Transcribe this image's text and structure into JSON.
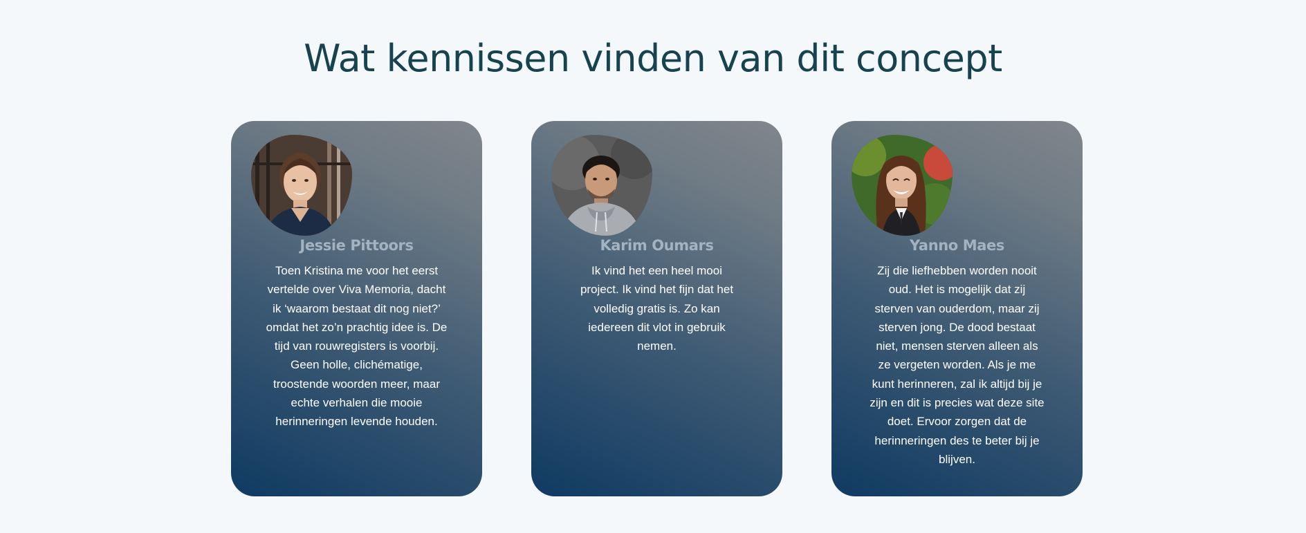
{
  "section": {
    "title": "Wat kennissen vinden van dit concept"
  },
  "testimonials": [
    {
      "name": "Jessie Pittoors",
      "quote": "Toen Kristina me voor het eerst vertelde over Viva Memoria, dacht ik ‘waarom bestaat dit nog niet?’ omdat het zo’n prachtig idee is. De tijd van rouwregisters is voorbij. Geen holle, clichématige, troostende woorden meer, maar echte verhalen die mooie herinneringen levende houden."
    },
    {
      "name": "Karim Oumars",
      "quote": "Ik vind het een heel mooi project. Ik vind het fijn dat het volledig gratis is. Zo kan iedereen dit vlot in gebruik nemen."
    },
    {
      "name": "Yanno Maes",
      "quote": "Zij die liefhebben worden nooit oud. Het is mogelijk dat zij sterven van ouderdom, maar zij sterven jong. De dood bestaat niet, mensen sterven alleen als ze vergeten worden. Als je me kunt herinneren, zal ik altijd bij je zijn en dit is precies wat deze site doet. Ervoor zorgen dat de herinneringen des te beter bij je blijven."
    }
  ],
  "colors": {
    "page_background": "#f4f8fb",
    "heading": "#17434f",
    "card_gradient_start": "#0f3a62",
    "card_gradient_end": "#80868c",
    "name": "#a3b3c2",
    "quote": "#ffffff"
  }
}
